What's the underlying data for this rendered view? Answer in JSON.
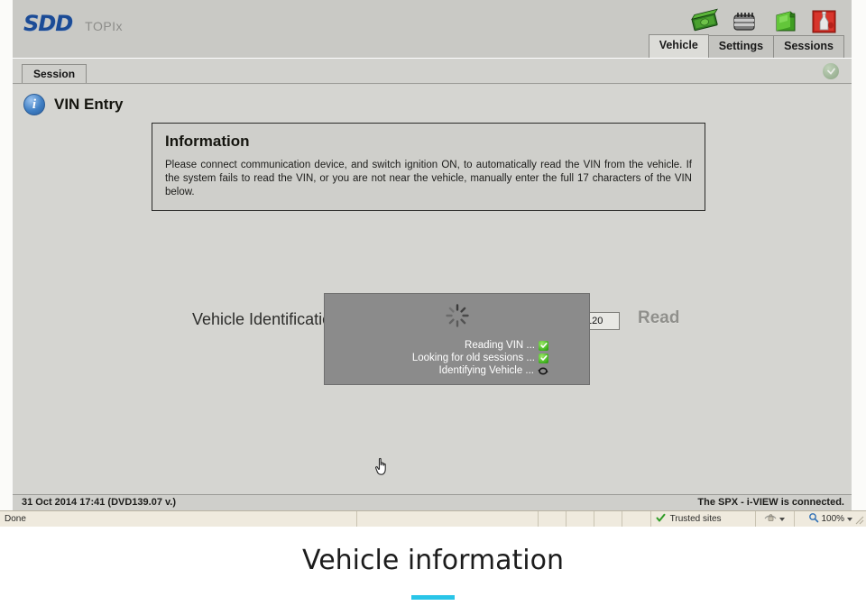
{
  "app": {
    "logo": "SDD",
    "product": "TOPIx",
    "header_icons": [
      {
        "name": "money-icon",
        "label": "Money"
      },
      {
        "name": "calendar-icon",
        "label": "Calendar"
      },
      {
        "name": "fuel-can-icon",
        "label": "Fuel can"
      },
      {
        "name": "fluid-bottle-icon",
        "label": "Fluid bottle"
      }
    ],
    "tabs": [
      {
        "label": "Vehicle",
        "active": true
      },
      {
        "label": "Settings",
        "active": false
      },
      {
        "label": "Sessions",
        "active": false
      }
    ]
  },
  "session_bar": {
    "tab_label": "Session",
    "collapse_icon": "collapse-up-icon"
  },
  "page": {
    "title": "VIN Entry",
    "title_icon": "info-circle-icon",
    "info_box": {
      "title": "Information",
      "text": "Please connect communication device, and switch ignition ON, to automatically read the VIN from the vehicle. If the system fails to read the VIN, or you are not near the vehicle, manually enter the full 17 characters of the VIN below."
    },
    "vin_row": {
      "label": "Vehicle Identification Number",
      "input_value": "120",
      "input_placeholder": "",
      "read_label": "Read"
    }
  },
  "modal": {
    "spinner_icon": "loading-spinner-icon",
    "lines": [
      {
        "text": "Reading VIN ...",
        "status": "done",
        "status_icon": "green-check-icon"
      },
      {
        "text": "Looking for old sessions ...",
        "status": "done",
        "status_icon": "green-check-icon"
      },
      {
        "text": "Identifying Vehicle ...",
        "status": "in-progress",
        "status_icon": "refresh-arrows-icon"
      }
    ]
  },
  "footer": {
    "left": "31 Oct 2014 17:41 (DVD139.07 v.)",
    "right": "The SPX - i-VIEW is connected."
  },
  "browser_status": {
    "page_status": "Done",
    "zone_label": "Trusted sites",
    "zone_icon": "green-check-icon",
    "security_icon": "security-zone-icon",
    "zoom_icon": "magnifier-icon",
    "zoom_level": "100%"
  },
  "caption": {
    "text": "Vehicle information",
    "accent_color": "#29c5e8"
  },
  "cursor": {
    "type": "pointing-hand-cursor"
  }
}
